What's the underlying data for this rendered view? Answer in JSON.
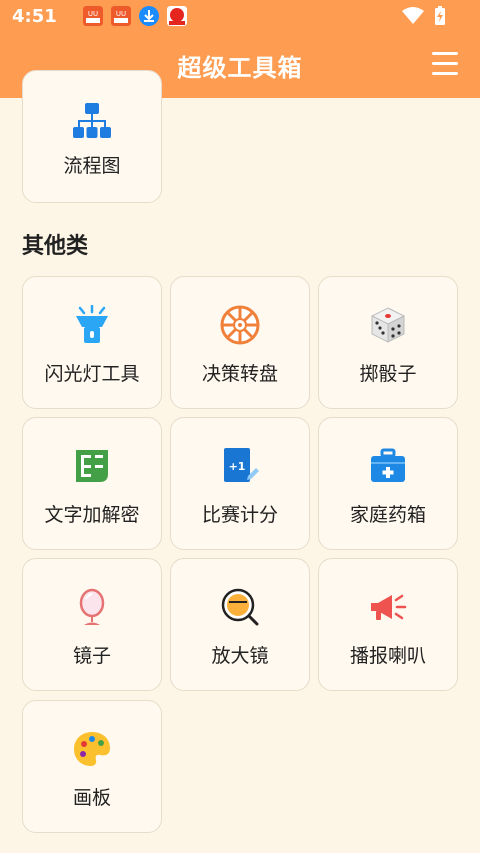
{
  "status_bar": {
    "time": "4:51",
    "notification_icons": [
      "uu-booster-icon",
      "uu-booster-icon",
      "download-icon",
      "red-app-icon"
    ],
    "system_icons": [
      "wifi-icon",
      "battery-charging-icon"
    ]
  },
  "app_bar": {
    "title": "超级工具箱",
    "menu_icon": "hamburger-menu-icon"
  },
  "top_card": {
    "label": "流程图",
    "icon": "flowchart-icon"
  },
  "section": {
    "title": "其他类"
  },
  "tools": [
    {
      "label": "闪光灯工具",
      "icon": "flashlight-icon"
    },
    {
      "label": "决策转盘",
      "icon": "wheel-icon"
    },
    {
      "label": "掷骰子",
      "icon": "dice-icon"
    },
    {
      "label": "文字加解密",
      "icon": "encrypt-icon"
    },
    {
      "label": "比赛计分",
      "icon": "score-icon"
    },
    {
      "label": "家庭药箱",
      "icon": "medicine-box-icon"
    },
    {
      "label": "镜子",
      "icon": "mirror-icon"
    },
    {
      "label": "放大镜",
      "icon": "magnifier-icon"
    },
    {
      "label": "播报喇叭",
      "icon": "megaphone-icon"
    },
    {
      "label": "画板",
      "icon": "palette-icon"
    }
  ],
  "colors": {
    "accent": "#fe9c51",
    "background": "#fdf5e6",
    "card_bg": "#fff9ef",
    "card_border": "#e7dccb"
  }
}
